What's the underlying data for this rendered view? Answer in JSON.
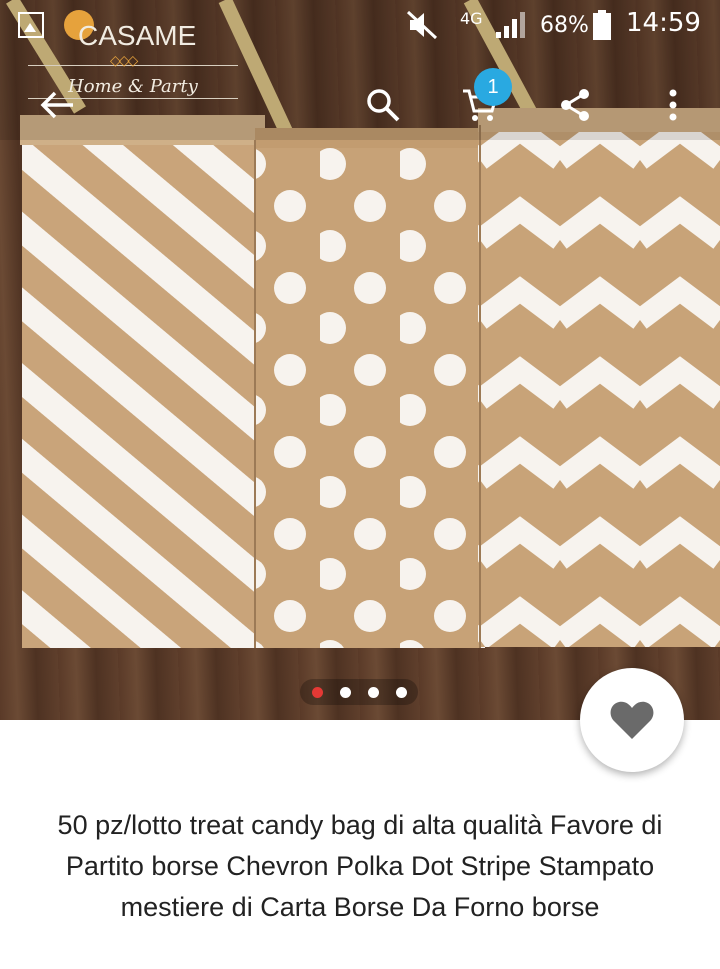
{
  "status_bar": {
    "network": "4G",
    "battery": "68%",
    "time": "14:59",
    "icons": [
      "gallery-icon",
      "mute-icon",
      "signal-icon",
      "battery-icon"
    ]
  },
  "logo": {
    "name": "CASAME",
    "tagline": "Home & Party"
  },
  "toolbar": {
    "icons": [
      "back-arrow-icon",
      "search-icon",
      "cart-icon",
      "share-icon",
      "more-vert-icon"
    ],
    "cart_badge": "1"
  },
  "gallery": {
    "page_count": 4,
    "active_index": 0,
    "active_color": "#e53935"
  },
  "favorite": {
    "icon": "heart-icon",
    "color": "#6a6a6a"
  },
  "product": {
    "title": "50 pz/lotto treat candy bag di alta qualità Favore di Partito borse Chevron Polka Dot Stripe Stampato mestiere di Carta Borse Da Forno borse"
  }
}
